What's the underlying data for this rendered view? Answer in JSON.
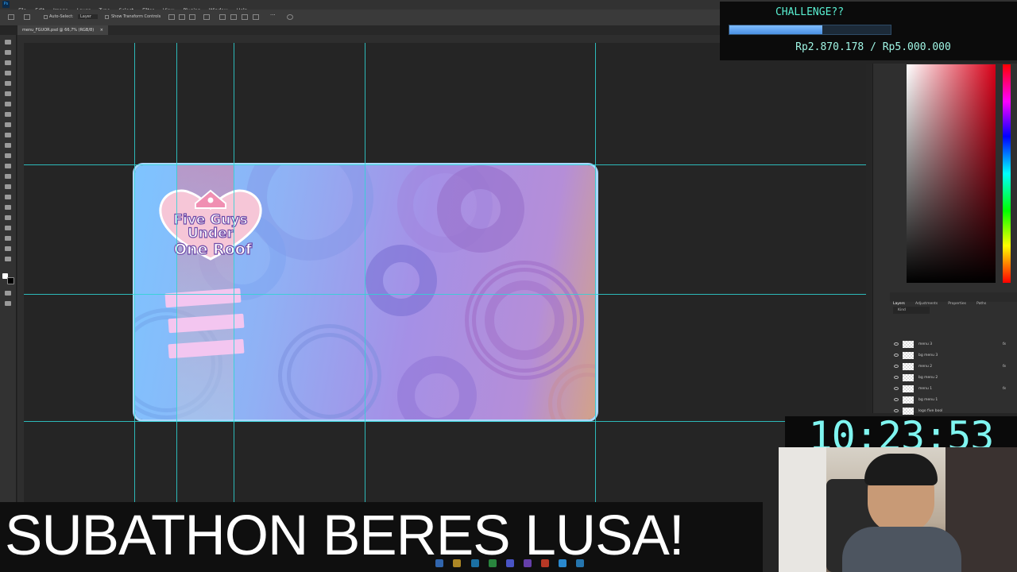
{
  "menubar": {
    "app_icon": "Ps",
    "items": [
      "File",
      "Edit",
      "Image",
      "Layer",
      "Type",
      "Select",
      "Filter",
      "View",
      "Plugins",
      "Window",
      "Help"
    ]
  },
  "options_bar": {
    "auto_select_label": "Auto-Select:",
    "auto_select_value": "Layer",
    "show_transform_controls_label": "Show Transform Controls"
  },
  "document": {
    "tab_title": "menu_FGUOR.psd @ 66,7% (RGB/8)"
  },
  "artwork": {
    "logo_lines": [
      "Five Guys",
      "Under",
      "One Roof"
    ]
  },
  "panels": {
    "tabs": [
      "Layers",
      "Adjustments",
      "Properties",
      "Paths"
    ],
    "kind_filter": "Kind",
    "layers": [
      {
        "name": "menu 3",
        "fx": "fx"
      },
      {
        "name": "bg menu 3",
        "fx": ""
      },
      {
        "name": "menu 2",
        "fx": "fx"
      },
      {
        "name": "bg menu 2",
        "fx": ""
      },
      {
        "name": "menu 1",
        "fx": "fx"
      },
      {
        "name": "bg menu 1",
        "fx": ""
      },
      {
        "name": "logo five bool",
        "fx": ""
      }
    ]
  },
  "overlay": {
    "challenge_title": "CHALLENGE??",
    "challenge_amount": "Rp2.870.178 / Rp5.000.000",
    "challenge_progress": 0.574,
    "timer": "10:23:53",
    "banner": "SUBATHON BERES LUSA!"
  },
  "colors": {
    "guide": "#2fd3d3",
    "overlay_text": "#59f0d2",
    "progress_fill": "#4a90e2"
  }
}
